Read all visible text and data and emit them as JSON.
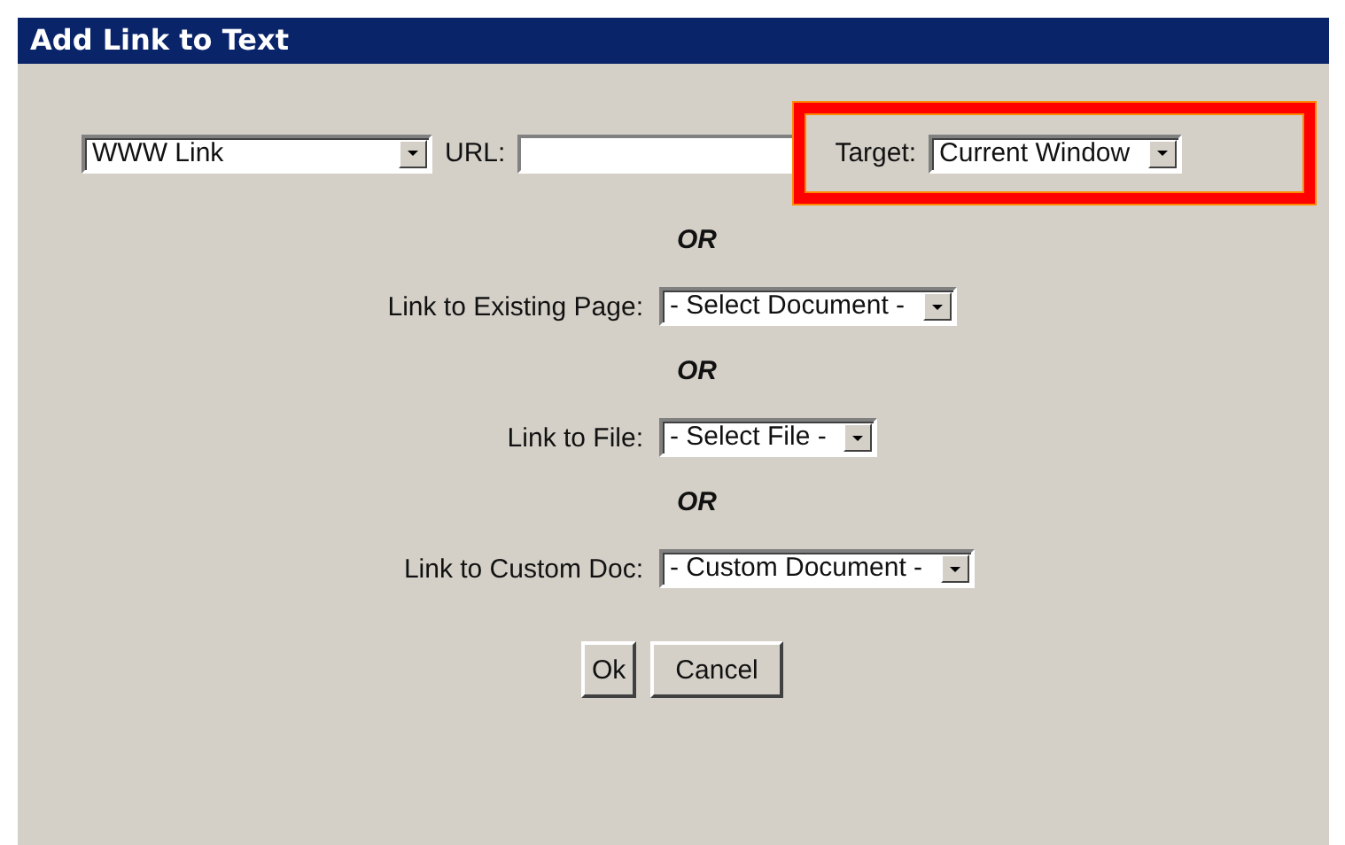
{
  "window": {
    "title": "Add Link to Text"
  },
  "link_type": {
    "value": "WWW Link"
  },
  "url": {
    "label": "URL:"
  },
  "target": {
    "label": "Target:",
    "value": "Current Window",
    "highlighted": true
  },
  "options": [
    {
      "kind": "separator",
      "text": "OR"
    },
    {
      "kind": "select",
      "label": "Link to Existing Page:",
      "value": "- Select Document -"
    },
    {
      "kind": "separator",
      "text": "OR"
    },
    {
      "kind": "select",
      "label": "Link to File:",
      "value": "- Select File -"
    },
    {
      "kind": "separator",
      "text": "OR"
    },
    {
      "kind": "select",
      "label": "Link to Custom Doc:",
      "value": "- Custom Document -"
    }
  ],
  "buttons": [
    "Ok",
    "Cancel"
  ]
}
